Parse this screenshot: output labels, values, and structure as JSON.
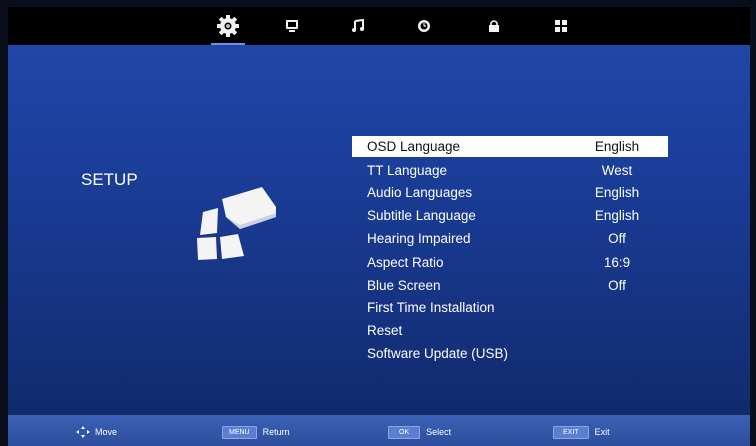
{
  "tabs": [
    {
      "icon": "gear-icon"
    },
    {
      "icon": "picture-icon"
    },
    {
      "icon": "music-note-icon"
    },
    {
      "icon": "clock-icon"
    },
    {
      "icon": "lock-icon"
    },
    {
      "icon": "grid-icon"
    }
  ],
  "page": {
    "title": "SETUP"
  },
  "menu": [
    {
      "label": "OSD Language",
      "value": "English"
    },
    {
      "label": "TT Language",
      "value": "West"
    },
    {
      "label": "Audio Languages",
      "value": "English"
    },
    {
      "label": "Subtitle Language",
      "value": "English"
    },
    {
      "label": "Hearing Impaired",
      "value": "Off"
    },
    {
      "label": "Aspect Ratio",
      "value": "16:9"
    },
    {
      "label": "Blue Screen",
      "value": "Off"
    },
    {
      "label": "First  Time Installation",
      "value": ""
    },
    {
      "label": "Reset",
      "value": ""
    },
    {
      "label": "Software Update (USB)",
      "value": ""
    }
  ],
  "footer": {
    "move": {
      "label": "Move"
    },
    "return": {
      "key": "MENU",
      "label": "Return"
    },
    "select": {
      "key": "OK",
      "label": "Select"
    },
    "exit": {
      "key": "EXIT",
      "label": "Exit"
    }
  },
  "colors": {
    "accent": "#1a3d98",
    "selected_row": "#ffffff",
    "footer": "#2b4d9c"
  }
}
